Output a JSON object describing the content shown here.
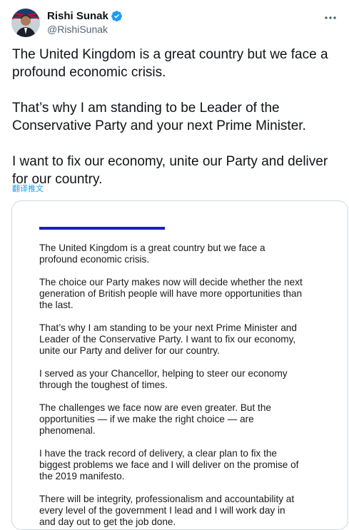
{
  "author": {
    "name": "Rishi Sunak",
    "handle": "@RishiSunak",
    "avatar_icon": "user-avatar",
    "verified_icon": "verified-badge-icon",
    "verified_color": "#1d9bf0"
  },
  "tweet": {
    "paragraphs": [
      "The United Kingdom is a great country but we face a profound economic crisis.",
      "That’s why I am standing to be Leader of the Conservative Party and your next Prime Minister.",
      "I want to fix our economy, unite our Party and deliver for our country."
    ],
    "translate_label": "翻译推文"
  },
  "attachment": {
    "accent_color": "#1a1ec8",
    "paragraphs": [
      "The United Kingdom is a great country but we face a profound economic crisis.",
      "The choice our Party makes now will decide whether the next generation of British people will have more opportunities than the last.",
      "That’s why I am standing to be your next Prime Minister and Leader of the Conservative Party. I want to fix our economy, unite our Party and deliver for our country.",
      "I served as your Chancellor, helping to steer our economy through the toughest of times.",
      "The challenges we face now are even greater. But the opportunities — if we make the right choice — are phenomenal.",
      "I have the track record of delivery, a clear plan to fix the biggest problems we face and I will deliver on the promise of the 2019 manifesto.",
      "There will be integrity, professionalism and accountability at every level of the government I lead and I will work day in and day out to get the job done."
    ]
  }
}
